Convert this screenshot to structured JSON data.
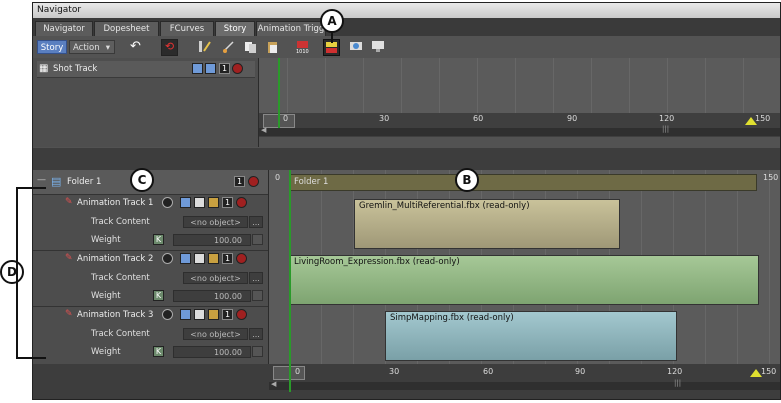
{
  "window": {
    "title": "Navigator"
  },
  "tabs": [
    {
      "label": "Navigator"
    },
    {
      "label": "Dopesheet"
    },
    {
      "label": "FCurves"
    },
    {
      "label": "Story"
    },
    {
      "label": "Animation Trigg"
    }
  ],
  "toolbar": {
    "story_label": "Story",
    "action_label": "Action"
  },
  "shot_track": {
    "label": "Shot Track",
    "toggle_label": "1"
  },
  "upper_ruler": {
    "ticks": [
      "0",
      "30",
      "60",
      "90",
      "120",
      "150"
    ],
    "scroll_mark": "|||"
  },
  "folder": {
    "label": "Folder 1",
    "toggle_label": "1",
    "timeline_label": "Folder 1",
    "start_tick": "0",
    "end_tick": "150"
  },
  "tracks": [
    {
      "name": "Animation Track 1",
      "content_label": "Track Content",
      "content_value": "<no object>",
      "weight_label": "Weight",
      "weight_value": "100.00",
      "key_label": "K",
      "toggle_label": "1",
      "more": "...",
      "clip": {
        "name": "Gremlin_MultiReferential.fbx (read-only)",
        "color": "#b7b088"
      }
    },
    {
      "name": "Animation Track 2",
      "content_label": "Track Content",
      "content_value": "<no object>",
      "weight_label": "Weight",
      "weight_value": "100.00",
      "key_label": "K",
      "toggle_label": "1",
      "more": "...",
      "clip": {
        "name": "LivingRoom_Expression.fbx (read-only)",
        "color": "#93b585"
      }
    },
    {
      "name": "Animation Track 3",
      "content_label": "Track Content",
      "content_value": "<no object>",
      "weight_label": "Weight",
      "weight_value": "100.00",
      "key_label": "K",
      "toggle_label": "1",
      "more": "...",
      "clip": {
        "name": "SimpMapping.fbx (read-only)",
        "color": "#8fb4bb"
      }
    }
  ],
  "lower_ruler": {
    "ticks": [
      "0",
      "30",
      "60",
      "90",
      "120",
      "150"
    ],
    "scroll_mark": "|||"
  },
  "callouts": [
    "A",
    "B",
    "C",
    "D"
  ],
  "colors": {
    "accent_tab": "#6c6c6c",
    "playhead": "#2a9a2a",
    "story_button": "#5a7fc0"
  }
}
